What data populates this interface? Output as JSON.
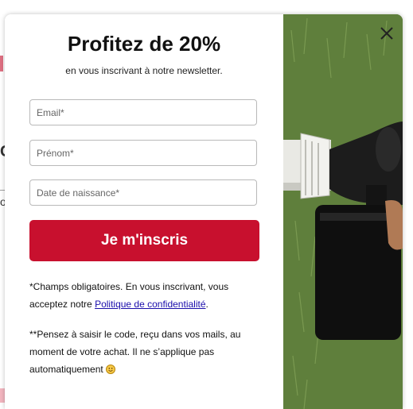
{
  "background": {
    "fragment_c": "C",
    "fragment_dash": "–",
    "fragment_o": "o"
  },
  "popup": {
    "title": "Profitez de 20%",
    "subtitle": "en vous inscrivant à notre newsletter.",
    "fields": {
      "email_placeholder": "Email*",
      "firstname_placeholder": "Prénom*",
      "birthdate_placeholder": "Date de naissance*"
    },
    "submit_label": "Je m'inscris",
    "legal": {
      "line1_prefix": "*Champs obligatoires. En vous inscrivant, vous acceptez notre ",
      "privacy_link": "Politique de confidentialité",
      "line1_suffix": ".",
      "line2": "**Pensez à saisir le code, reçu dans vos mails, au moment de votre achat. Il ne s’applique pas automatiquement "
    },
    "close_icon": "close-icon",
    "emoji_icon": "smiley-icon"
  },
  "colors": {
    "accent": "#c8102e",
    "link": "#1a0dab",
    "text": "#111111",
    "field_border": "#b9b9b9"
  }
}
